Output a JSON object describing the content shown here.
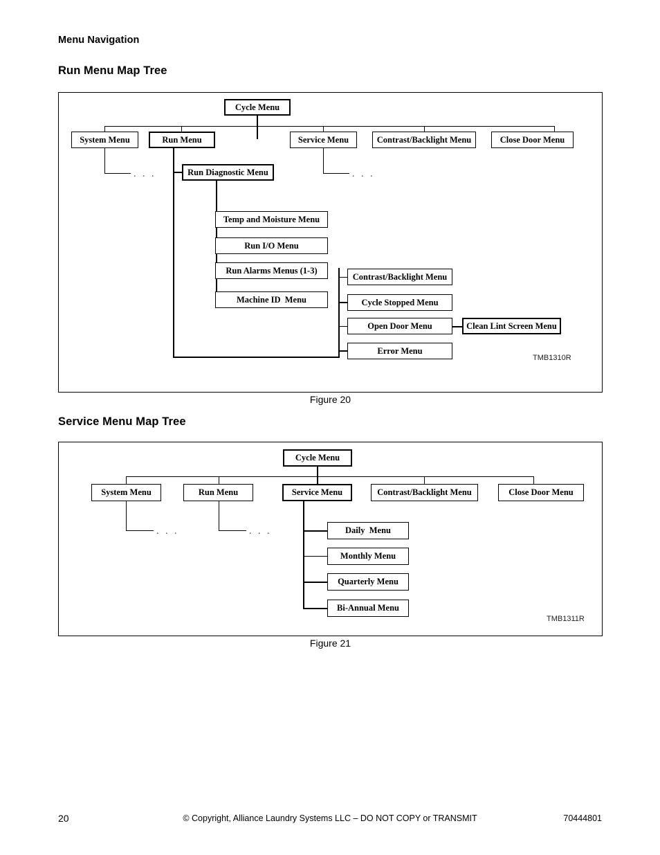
{
  "page": {
    "running_head": "Menu Navigation",
    "number": "20"
  },
  "footer": {
    "page_number": "20",
    "copyright": "© Copyright, Alliance Laundry Systems LLC – DO NOT COPY or TRANSMIT",
    "doc_number": "70444801"
  },
  "figures": [
    {
      "title": "Run Menu Map Tree",
      "caption": "Figure 20",
      "code": "TMB1310R",
      "nodes": {
        "cycle_menu": "Cycle Menu",
        "system_menu": "System Menu",
        "run_menu": "Run Menu",
        "service_menu": "Service Menu",
        "contrast_backlight_menu": "Contrast/Backlight Menu",
        "close_door_menu": "Close Door Menu",
        "run_diagnostic_menu": "Run Diagnostic Menu",
        "temp_moisture_menu": "Temp and Moisture Menu",
        "run_io_menu": "Run I/O Menu",
        "run_alarms_menus": "Run Alarms Menus (1-3)",
        "machine_id_menu": "Machine ID  Menu",
        "contrast_backlight_menu_2": "Contrast/Backlight Menu",
        "cycle_stopped_menu": "Cycle Stopped Menu",
        "open_door_menu": "Open Door Menu",
        "clean_lint_screen_menu": "Clean Lint Screen Menu",
        "error_menu": "Error Menu"
      },
      "ellipsis": ". . ."
    },
    {
      "title": "Service Menu Map Tree",
      "caption": "Figure 21",
      "code": "TMB1311R",
      "nodes": {
        "cycle_menu": "Cycle Menu",
        "system_menu": "System Menu",
        "run_menu": "Run Menu",
        "service_menu": "Service Menu",
        "contrast_backlight_menu": "Contrast/Backlight Menu",
        "close_door_menu": "Close Door Menu",
        "daily_menu": "Daily  Menu",
        "monthly_menu": "Monthly Menu",
        "quarterly_menu": "Quarterly Menu",
        "bi_annual_menu": "Bi-Annual Menu"
      },
      "ellipsis": ". . ."
    }
  ],
  "chart_data": {
    "type": "diagram",
    "diagrams": [
      {
        "title": "Run Menu Map Tree",
        "root": "Cycle Menu",
        "highlighted_path": [
          "Cycle Menu",
          "Run Menu",
          "Run Diagnostic Menu"
        ],
        "edges": [
          [
            "Cycle Menu",
            "System Menu"
          ],
          [
            "Cycle Menu",
            "Run Menu"
          ],
          [
            "Cycle Menu",
            "Service Menu"
          ],
          [
            "Cycle Menu",
            "Contrast/Backlight Menu"
          ],
          [
            "Cycle Menu",
            "Close Door Menu"
          ],
          [
            "Run Menu",
            "Run Diagnostic Menu"
          ],
          [
            "Run Diagnostic Menu",
            "Temp and Moisture Menu"
          ],
          [
            "Run Diagnostic Menu",
            "Run I/O Menu"
          ],
          [
            "Run Diagnostic Menu",
            "Run Alarms Menus (1-3)"
          ],
          [
            "Run Diagnostic Menu",
            "Machine ID  Menu"
          ],
          [
            "Run Diagnostic Menu",
            "Contrast/Backlight Menu"
          ],
          [
            "Run Diagnostic Menu",
            "Cycle Stopped Menu"
          ],
          [
            "Run Diagnostic Menu",
            "Open Door Menu"
          ],
          [
            "Run Diagnostic Menu",
            "Error Menu"
          ],
          [
            "Open Door Menu",
            "Clean Lint Screen Menu"
          ]
        ]
      },
      {
        "title": "Service Menu Map Tree",
        "root": "Cycle Menu",
        "highlighted_path": [
          "Cycle Menu",
          "Service Menu"
        ],
        "edges": [
          [
            "Cycle Menu",
            "System Menu"
          ],
          [
            "Cycle Menu",
            "Run Menu"
          ],
          [
            "Cycle Menu",
            "Service Menu"
          ],
          [
            "Cycle Menu",
            "Contrast/Backlight Menu"
          ],
          [
            "Cycle Menu",
            "Close Door Menu"
          ],
          [
            "Service Menu",
            "Daily  Menu"
          ],
          [
            "Service Menu",
            "Monthly Menu"
          ],
          [
            "Service Menu",
            "Quarterly Menu"
          ],
          [
            "Service Menu",
            "Bi-Annual Menu"
          ]
        ]
      }
    ]
  }
}
